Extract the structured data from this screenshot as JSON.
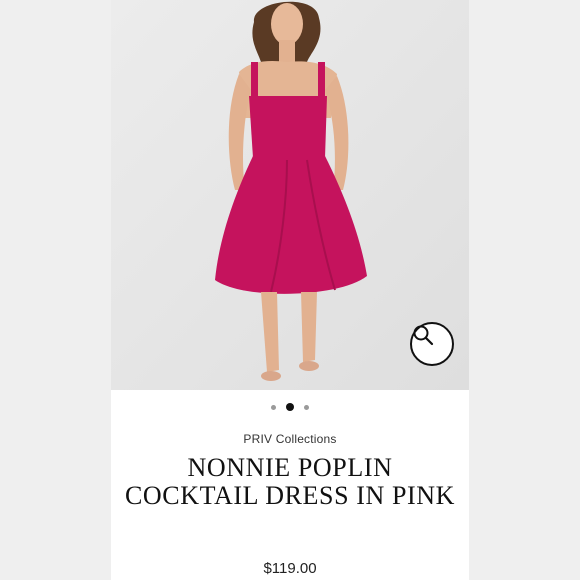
{
  "product": {
    "brand": "PRIV Collections",
    "title": "NONNIE POPLIN COCKTAIL DRESS IN PINK",
    "price": "$119.00",
    "dress_color": "#c5135d"
  },
  "gallery": {
    "image_count": 3,
    "active_index": 1,
    "zoom_icon": "search-icon"
  },
  "colors": {
    "background": "#ffffff",
    "page_gutter": "#efefef",
    "image_background": "#e6e6e6",
    "text": "#111111"
  }
}
